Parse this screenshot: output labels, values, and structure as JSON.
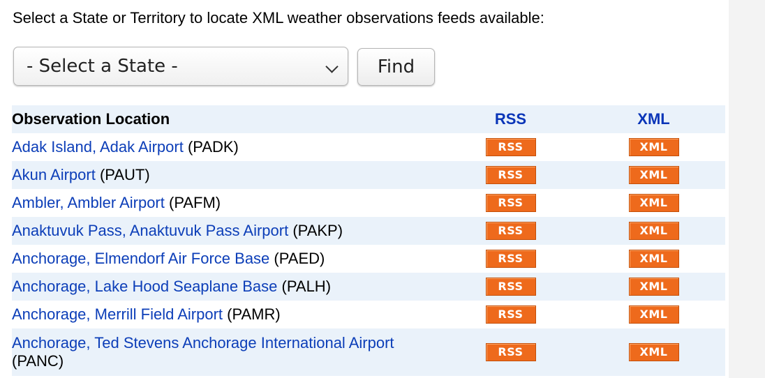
{
  "intro_text": "Select a State or Territory to locate XML weather observations feeds available:",
  "state_select": {
    "selected": "- Select a State -"
  },
  "find_button": {
    "label": "Find"
  },
  "table": {
    "headers": {
      "location": "Observation Location",
      "rss": "RSS",
      "xml": "XML"
    },
    "rss_badge": "RSS",
    "xml_badge": "XML",
    "rows": [
      {
        "name": "Adak Island, Adak Airport",
        "code": "(PADK)"
      },
      {
        "name": "Akun Airport",
        "code": "(PAUT)"
      },
      {
        "name": "Ambler, Ambler Airport",
        "code": "(PAFM)"
      },
      {
        "name": "Anaktuvuk Pass, Anaktuvuk Pass Airport",
        "code": "(PAKP)"
      },
      {
        "name": "Anchorage, Elmendorf Air Force Base",
        "code": "(PAED)"
      },
      {
        "name": "Anchorage, Lake Hood Seaplane Base",
        "code": "(PALH)"
      },
      {
        "name": "Anchorage, Merrill Field Airport",
        "code": "(PAMR)"
      },
      {
        "name": "Anchorage, Ted Stevens Anchorage International Airport",
        "code": "(PANC)"
      }
    ]
  },
  "colors": {
    "link": "#0c3eb8",
    "header_accent": "#0a35b8",
    "row_stripe": "#eaf2fa",
    "badge": "#ee6a1c"
  }
}
